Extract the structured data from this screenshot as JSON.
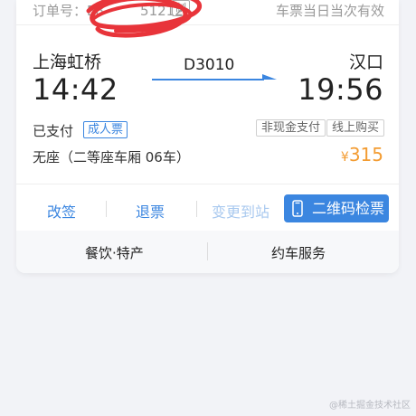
{
  "order": {
    "label_partial": "订单号：E8",
    "number_partial": "51212",
    "tag_partial": "制",
    "valid_note": "车票当日当次有效"
  },
  "trip": {
    "from": "上海虹桥",
    "to": "汉口",
    "train_no": "D3010",
    "depart_time": "14:42",
    "arrive_time": "19:56"
  },
  "status": {
    "paid": "已支付",
    "ticket_type": "成人票",
    "pay_tags": [
      "非现金支付",
      "线上购买"
    ],
    "seat": "无座（二等座车厢 06车）",
    "currency": "¥",
    "price": "315"
  },
  "actions": {
    "rebook": "改签",
    "refund": "退票",
    "change_station": "变更到站",
    "qr_check": "二维码检票"
  },
  "services": {
    "dining": "餐饮·特产",
    "car": "约车服务"
  },
  "watermark": "@稀土掘金技术社区",
  "colors": {
    "accent": "#3b86e0",
    "price": "#f39c32",
    "scribble": "#e8343a"
  },
  "icons": {
    "qr_button_icon": "phone-icon"
  }
}
